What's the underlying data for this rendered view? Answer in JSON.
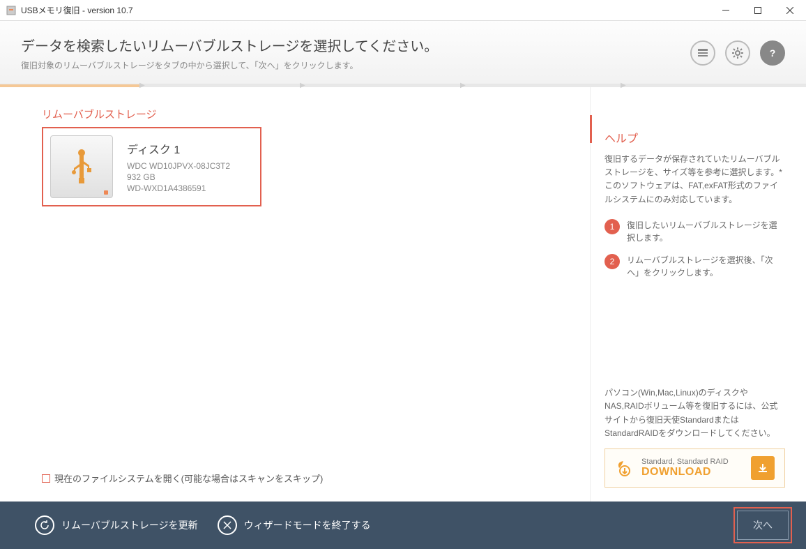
{
  "window": {
    "title": "USBメモリ復旧 - version 10.7"
  },
  "header": {
    "title": "データを検索したいリムーバブルストレージを選択してください。",
    "subtitle": "復旧対象のリムーバブルストレージをタブの中から選択して、「次へ」をクリックします。"
  },
  "main": {
    "section_label": "リムーバブルストレージ",
    "disk": {
      "name": "ディスク 1",
      "model": "WDC WD10JPVX-08JC3T2",
      "size": "932 GB",
      "serial": "WD-WXD1A4386591"
    },
    "checkbox_label": "現在のファイルシステムを開く(可能な場合はスキャンをスキップ)"
  },
  "help": {
    "title": "ヘルプ",
    "intro": "復旧するデータが保存されていたリムーバブルストレージを、サイズ等を参考に選択します。*このソフトウェアは、FAT,exFAT形式のファイルシステムにのみ対応しています。",
    "steps": [
      "復旧したいリムーバブルストレージを選択します。",
      "リムーバブルストレージを選択後、「次へ」をクリックします。"
    ],
    "download_text": "パソコン(Win,Mac,Linux)のディスクやNAS,RAIDボリューム等を復旧するには、公式サイトから復旧天使StandardまたはStandardRAIDをダウンロードしてください。",
    "download_label_small": "Standard, Standard RAID",
    "download_label_big": "DOWNLOAD"
  },
  "footer": {
    "refresh": "リムーバブルストレージを更新",
    "exit": "ウィザードモードを終了する",
    "next": "次へ"
  }
}
